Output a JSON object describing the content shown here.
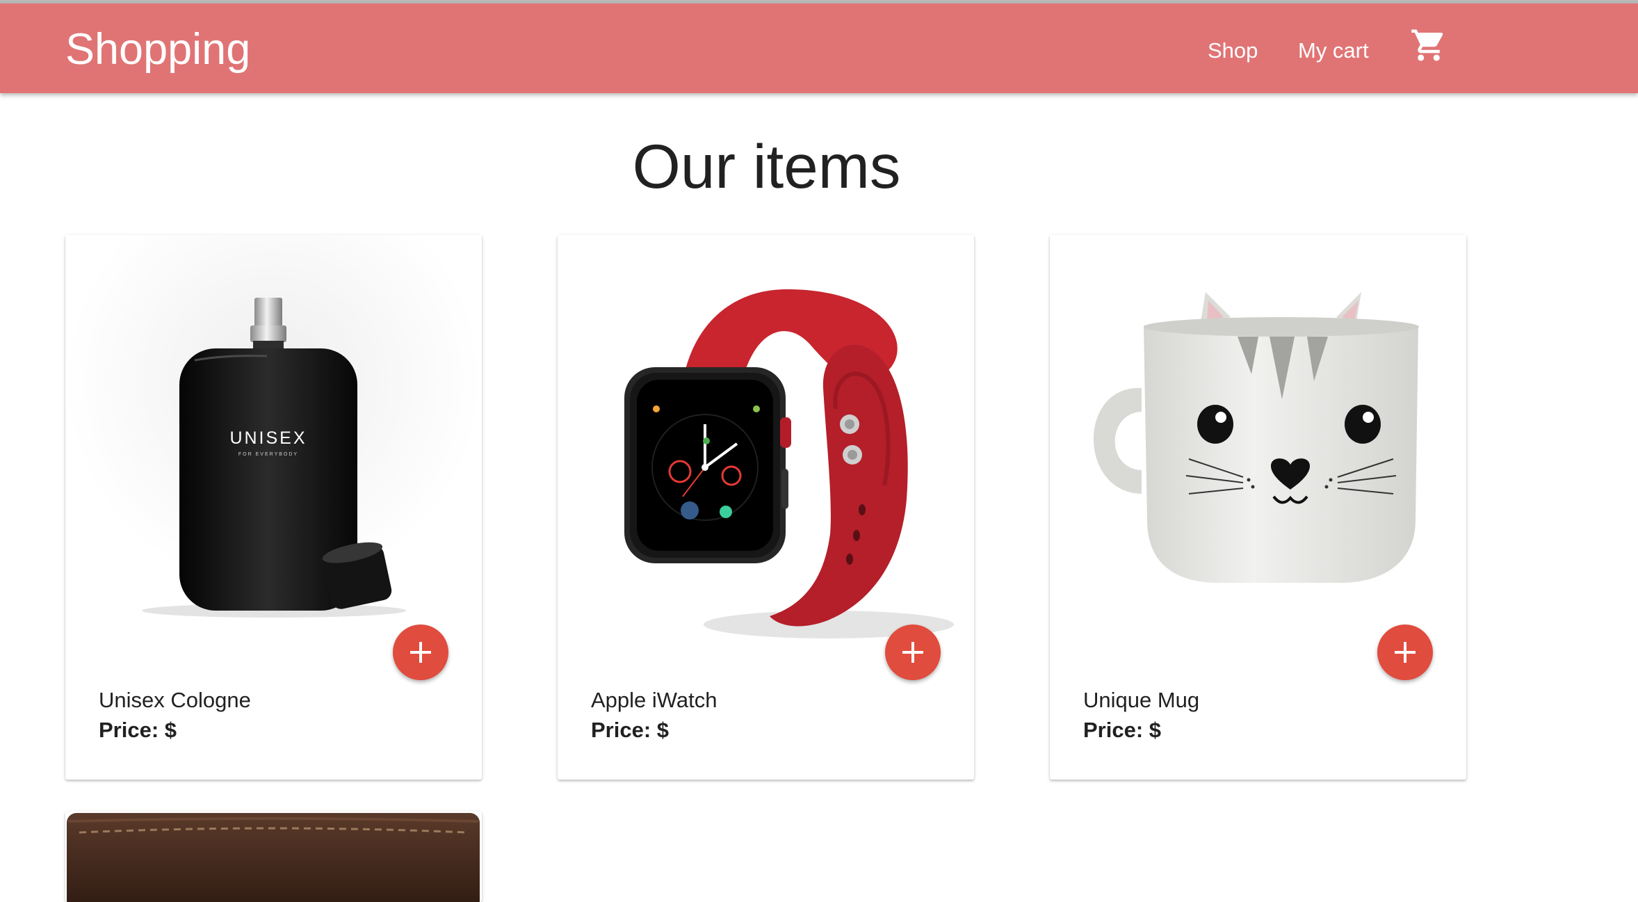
{
  "navbar": {
    "brand": "Shopping",
    "links": [
      "Shop",
      "My cart"
    ],
    "cart_icon": "shopping-cart-icon"
  },
  "page": {
    "title": "Our items"
  },
  "products": [
    {
      "name": "Unisex Cologne",
      "price_label": "Price: $",
      "image": "cologne-bottle",
      "bottle_text": "UNISEX",
      "bottle_subtext": "FOR EVERYBODY"
    },
    {
      "name": "Apple iWatch",
      "price_label": "Price: $",
      "image": "red-smartwatch"
    },
    {
      "name": "Unique Mug",
      "price_label": "Price: $",
      "image": "cat-mug"
    }
  ],
  "add_button_icon": "plus-icon",
  "partial_product_image": "brown-leather-wallet",
  "colors": {
    "navbar": "#e07475",
    "add_button": "#e04c3d",
    "watch_band": "#c8252f"
  }
}
